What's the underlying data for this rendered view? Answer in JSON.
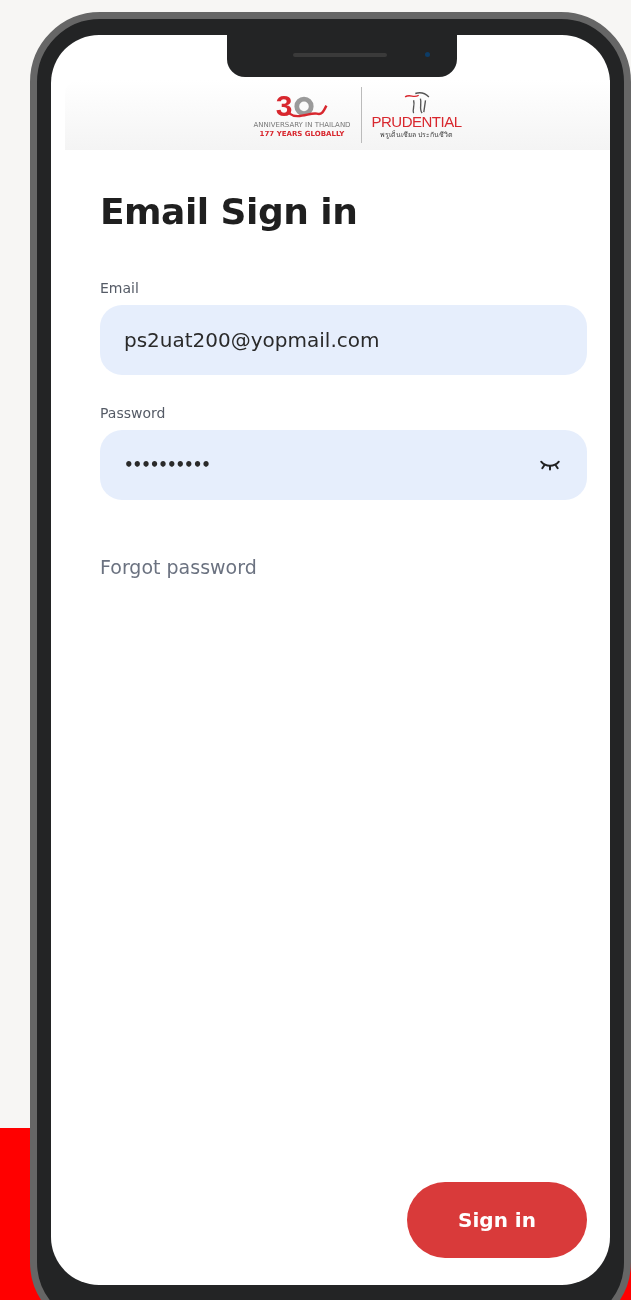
{
  "logo": {
    "anniversary_number": "3",
    "anniversary_caption": "ANNIVERSARY IN THAILAND",
    "anniversary_subcaption": "177 YEARS GLOBALLY",
    "brand": "PRUDENTIAL",
    "brand_thai": "พรูเด็นเชียล ประกันชีวิต"
  },
  "title": "Email Sign in",
  "fields": [
    {
      "label": "Email",
      "value": "ps2uat200@yopmail.com",
      "kind": "text"
    },
    {
      "label": "Password",
      "value": "••••••••••",
      "kind": "password"
    }
  ],
  "forgot_link": "Forgot password",
  "submit_button": "Sign in"
}
